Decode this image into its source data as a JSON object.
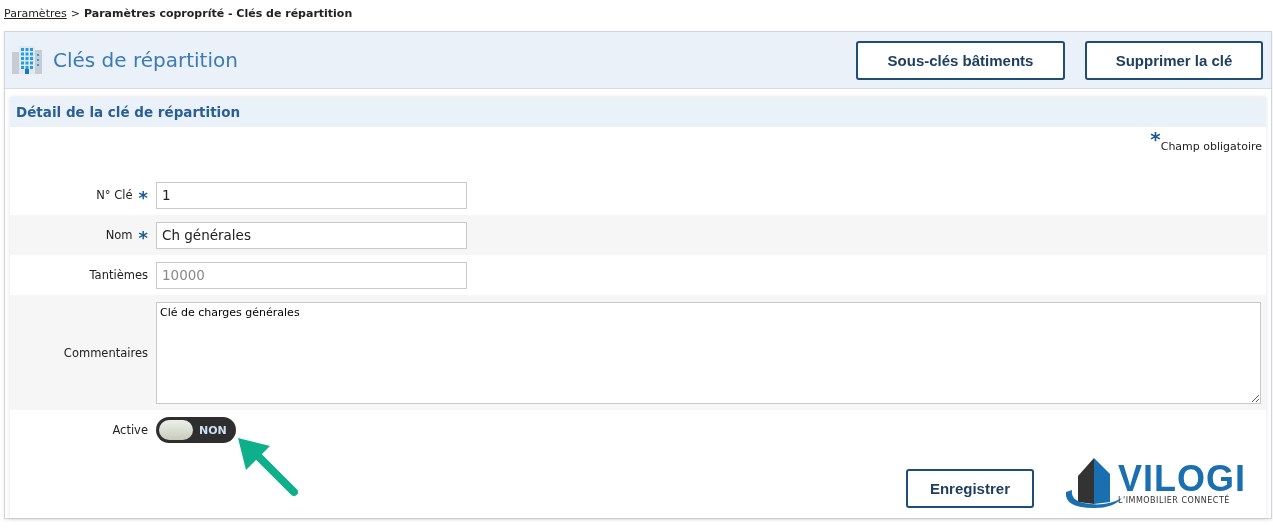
{
  "breadcrumb": {
    "link": "Paramètres",
    "separator": ">",
    "current": "Paramètres copropríté - Clés de répartition"
  },
  "header": {
    "title": "Clés de répartition",
    "buttons": [
      "Sous-clés bâtiments",
      "Supprimer la clé"
    ]
  },
  "section": {
    "title": "Détail de la clé de répartition",
    "required_mark": "*",
    "required_note": "Champ obligatoire",
    "fields": [
      {
        "kind": "input",
        "label": "N° Clé",
        "required": true,
        "value": "1"
      },
      {
        "kind": "input",
        "label": "Nom",
        "required": true,
        "value": "Ch générales"
      },
      {
        "kind": "input",
        "label": "Tantièmes",
        "required": false,
        "placeholder": "10000"
      },
      {
        "kind": "textarea",
        "label": "Commentaires",
        "required": false,
        "value": "Clé de charges générales"
      },
      {
        "kind": "toggle",
        "label": "Active",
        "required": false,
        "on": false,
        "state_label": "NON"
      }
    ],
    "save_button": "Enregistrer"
  },
  "logo": {
    "name": "VILOGI",
    "tagline": "L'IMMOBILIER CONNECTÉ"
  }
}
